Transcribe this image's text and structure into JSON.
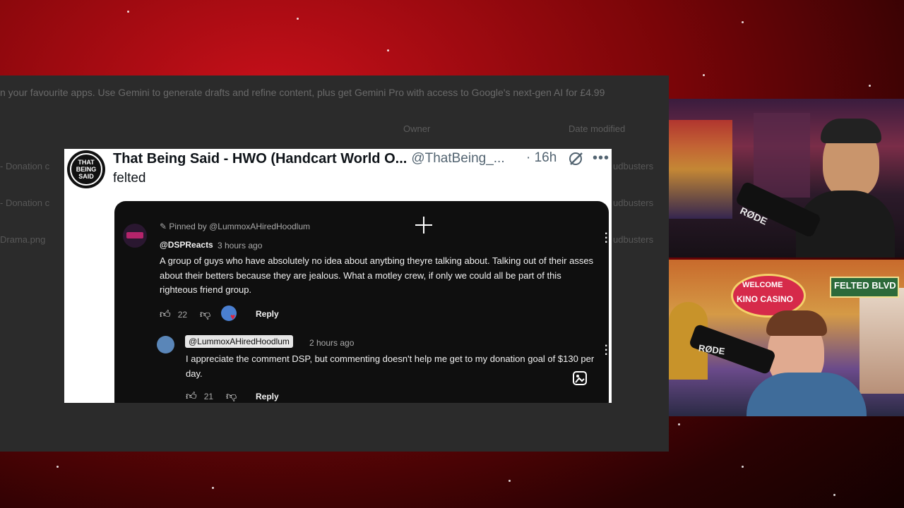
{
  "desktop": {
    "banner": "n your favourite apps. Use Gemini to generate drafts and refine content, plus get Gemini Pro with access to Google's next-gen AI for £4.99",
    "col_owner": "Owner",
    "col_date": "Date modified",
    "rows": [
      "- Donation c",
      "- Donation c",
      "Drama.png"
    ],
    "right_cells": [
      "udbusters",
      "udbusters",
      "udbusters"
    ]
  },
  "tweet": {
    "avatar_text": "THAT BEING SAID",
    "name": "That Being Said - HWO (Handcart World O...",
    "handle": "@ThatBeing_...",
    "time": "· 16h",
    "body": "felted"
  },
  "youtube": {
    "pinned": "Pinned by @LummoxAHiredHoodlum",
    "comment1": {
      "author": "@DSPReacts",
      "time": "3 hours ago",
      "text": "A group of guys who have absolutely no idea about anytbing theyre talking about. Talking out of their asses about their betters because they are jealous. What a motley crew, if only we could all be part of this righteous friend group.",
      "likes": "22",
      "reply": "Reply"
    },
    "comment2": {
      "author": "@LummoxAHiredHoodlum",
      "time": "2 hours ago",
      "text": "I appreciate the comment DSP, but commenting doesn't help me get to my donation goal of $130 per day.",
      "likes": "21",
      "reply": "Reply"
    }
  },
  "webcam": {
    "mic_brand_1": "RØDE",
    "mic_brand_2": "RØDE",
    "sign_welcome": "WELCOME",
    "sign_casino": "KINO CASINO",
    "sign_street": "FELTED BLVD"
  }
}
